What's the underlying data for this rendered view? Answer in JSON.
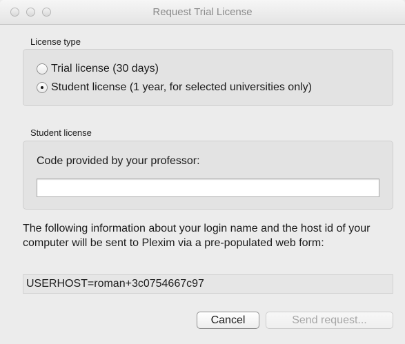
{
  "window": {
    "title": "Request Trial License"
  },
  "license_type": {
    "label": "License type",
    "options": [
      {
        "label": "Trial license (30 days)",
        "selected": false
      },
      {
        "label": "Student license (1 year, for selected universities only)",
        "selected": true
      }
    ]
  },
  "student_license": {
    "label": "Student license",
    "code_label": "Code provided by your professor:",
    "code_value": ""
  },
  "info": {
    "text": "The following information about your login name and the host id of your computer will be sent to Plexim via a pre-populated web form:",
    "userhost": "USERHOST=roman+3c0754667c97"
  },
  "buttons": {
    "cancel": "Cancel",
    "send": "Send request..."
  }
}
